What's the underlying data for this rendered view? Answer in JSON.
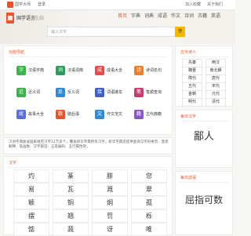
{
  "topbar": {
    "left_text": "国学大师",
    "mid_text": "登录",
    "right_links": [
      "加入收藏",
      "关于我们"
    ]
  },
  "brand": {
    "name": "国学语言",
    "sub": "在线"
  },
  "nav": {
    "items": [
      {
        "label": "首页",
        "active": true
      },
      {
        "label": "字典",
        "active": false
      },
      {
        "label": "词典",
        "active": false
      },
      {
        "label": "成语",
        "active": false
      },
      {
        "label": "作文",
        "active": false
      },
      {
        "label": "诗词",
        "active": false
      },
      {
        "label": "古籍",
        "active": false
      },
      {
        "label": "英语",
        "active": false
      }
    ]
  },
  "search": {
    "placeholder": "输入汉字",
    "button_label": "搜"
  },
  "tools": {
    "title": "功能导航",
    "items": [
      {
        "label": "汉语字典",
        "icon": "字",
        "color": "#3bb34a"
      },
      {
        "label": "汉语词典",
        "icon": "词",
        "color": "#2f9c5c"
      },
      {
        "label": "成语大全",
        "icon": "成",
        "color": "#e24c4c"
      },
      {
        "label": "诗词名句",
        "icon": "诗",
        "color": "#e5822f"
      },
      {
        "label": "近义词",
        "icon": "近",
        "color": "#3bb34a"
      },
      {
        "label": "反义词",
        "icon": "反",
        "color": "#2e8cd6"
      },
      {
        "label": "词语接龙",
        "icon": "接",
        "color": "#3d5fc6"
      },
      {
        "label": "笔顺查询",
        "icon": "笔",
        "color": "#c73b6f"
      },
      {
        "label": "故事大全",
        "icon": "故",
        "color": "#5b6fd9"
      },
      {
        "label": "歇后语",
        "icon": "歇",
        "color": "#e8542e"
      },
      {
        "label": "作文范文",
        "icon": "文",
        "color": "#2e8cd6"
      },
      {
        "label": "古代典籍",
        "icon": "籍",
        "color": "#8a55c4"
      }
    ]
  },
  "intro": {
    "text": "汉语字典收录国家规范汉字12万多个，覆盖新华字典所有汉字。新华字典还提供查询汉字的拼音、意思解释、笔画数、汉字部首、五笔编码、五行属性等。"
  },
  "ziti": {
    "title": "汉字",
    "chars": [
      "灼",
      "篆",
      "腓",
      "您",
      "易",
      "瓦",
      "溉",
      "翠",
      "颖",
      "铜",
      "炯",
      "孤",
      "摆",
      "翘",
      "罚",
      "栎",
      "惦",
      "蔬",
      "讶",
      "唯"
    ]
  },
  "poets": {
    "title": "古今诗人",
    "items": [
      "先秦",
      "两汉",
      "魏晋",
      "南北朝",
      "隋代",
      "唐代",
      "五代",
      "宋代",
      "金朝",
      "元代",
      "明代",
      "清代"
    ]
  },
  "daily_char": {
    "title": "每日汉字",
    "value": "鄙人"
  },
  "daily_idiom": {
    "title": "每日成语",
    "value": "屈指可数"
  }
}
